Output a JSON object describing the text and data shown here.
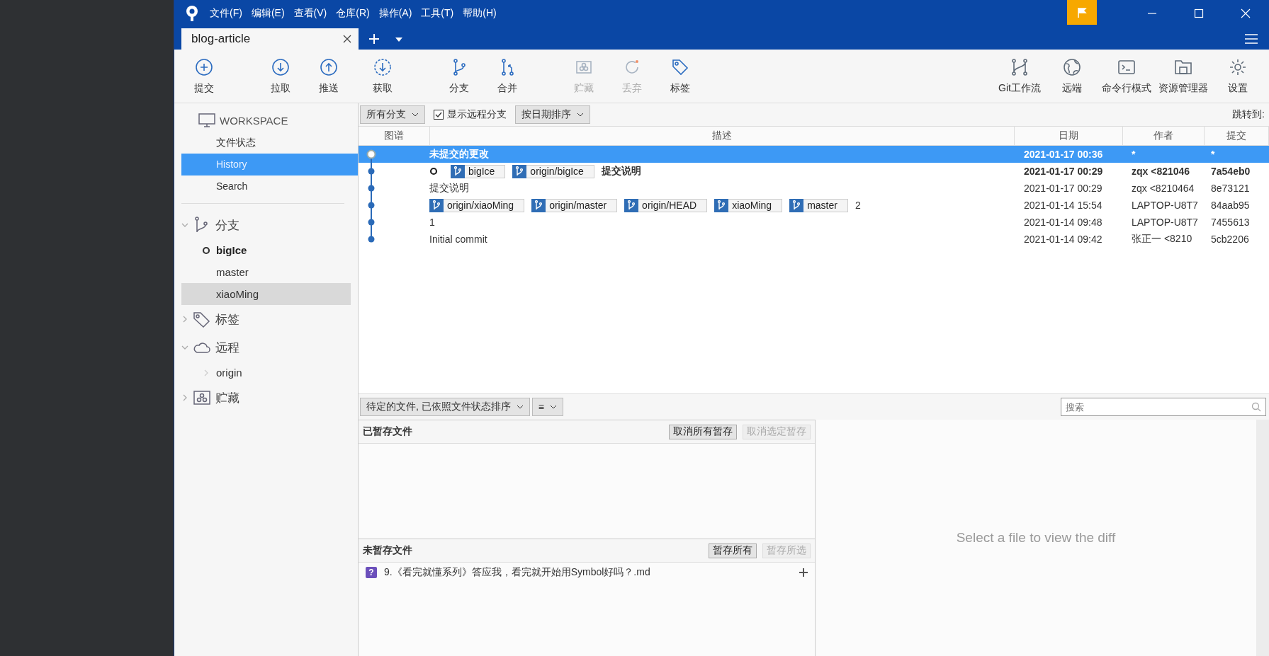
{
  "menu": [
    "文件(F)",
    "编辑(E)",
    "查看(V)",
    "仓库(R)",
    "操作(A)",
    "工具(T)",
    "帮助(H)"
  ],
  "tabs": [
    {
      "label": "blog-article",
      "selected": true
    }
  ],
  "toolbar": [
    {
      "kind": "commit",
      "label": "提交",
      "disabled": false
    },
    {
      "kind": "pull",
      "label": "拉取",
      "disabled": false
    },
    {
      "kind": "push",
      "label": "推送",
      "disabled": false
    },
    {
      "kind": "fetch",
      "label": "获取",
      "disabled": false
    },
    {
      "kind": "branch",
      "label": "分支",
      "disabled": false
    },
    {
      "kind": "merge",
      "label": "合并",
      "disabled": false
    },
    {
      "kind": "stash",
      "label": "贮藏",
      "disabled": true
    },
    {
      "kind": "discard",
      "label": "丢弃",
      "disabled": true
    },
    {
      "kind": "tag",
      "label": "标签",
      "disabled": false
    }
  ],
  "toolbar_right": [
    {
      "kind": "flow",
      "label": "Git工作流"
    },
    {
      "kind": "remote",
      "label": "远端"
    },
    {
      "kind": "terminal",
      "label": "命令行模式"
    },
    {
      "kind": "explorer",
      "label": "资源管理器"
    },
    {
      "kind": "settings",
      "label": "设置"
    }
  ],
  "sidebar": {
    "workspace": {
      "title": "WORKSPACE",
      "items": [
        {
          "label": "文件状态",
          "selected": false
        },
        {
          "label": "History",
          "selected": true
        },
        {
          "label": "Search",
          "selected": false
        }
      ]
    },
    "sections": [
      {
        "kind": "branches",
        "title": "分支",
        "expanded": true,
        "children": [
          {
            "label": "bigIce",
            "current": true,
            "selected": false
          },
          {
            "label": "master",
            "current": false,
            "selected": false
          },
          {
            "label": "xiaoMing",
            "current": false,
            "selected": true
          }
        ]
      },
      {
        "kind": "tags",
        "title": "标签",
        "expanded": false
      },
      {
        "kind": "remotes",
        "title": "远程",
        "expanded": true,
        "children": [
          {
            "label": "origin",
            "current": false,
            "selected": false
          }
        ]
      },
      {
        "kind": "stashes",
        "title": "贮藏",
        "expanded": false
      }
    ]
  },
  "filters": {
    "branches": "所有分支",
    "show_remote": {
      "label": "显示远程分支",
      "checked": true
    },
    "sort": "按日期排序",
    "jump": "跳转到:"
  },
  "table": {
    "columns": [
      "图谱",
      "描述",
      "日期",
      "作者",
      "提交"
    ],
    "rows": [
      {
        "kind": "uncommitted",
        "selected": true,
        "bold": true,
        "refs": [],
        "message": "未提交的更改",
        "date": "2021-01-17 00:36",
        "author": "*",
        "commit": "*"
      },
      {
        "kind": "commit",
        "selected": false,
        "bold": true,
        "refs": [
          {
            "label": "bigIce",
            "current": true
          },
          {
            "label": "origin/bigIce",
            "current": false
          }
        ],
        "message": "提交说明",
        "date": "2021-01-17 00:29",
        "author": "zqx <821046",
        "commit": "7a54eb0"
      },
      {
        "kind": "commit",
        "selected": false,
        "bold": false,
        "refs": [],
        "message": "提交说明",
        "date": "2021-01-17 00:29",
        "author": "zqx <8210464",
        "commit": "8e73121"
      },
      {
        "kind": "commit",
        "selected": false,
        "bold": false,
        "refs": [
          {
            "label": "origin/xiaoMing",
            "current": false
          },
          {
            "label": "origin/master",
            "current": false
          },
          {
            "label": "origin/HEAD",
            "current": false
          },
          {
            "label": "xiaoMing",
            "current": false
          },
          {
            "label": "master",
            "current": false
          }
        ],
        "message": "2",
        "date": "2021-01-14 15:54",
        "author": "LAPTOP-U8T7",
        "commit": "84aab95"
      },
      {
        "kind": "commit",
        "selected": false,
        "bold": false,
        "refs": [],
        "message": "1",
        "date": "2021-01-14 09:48",
        "author": "LAPTOP-U8T7",
        "commit": "7455613"
      },
      {
        "kind": "commit",
        "selected": false,
        "bold": false,
        "refs": [],
        "message": "Initial commit",
        "date": "2021-01-14 09:42",
        "author": "张正一 <8210",
        "commit": "5cb2206"
      }
    ]
  },
  "files_bar": {
    "sort": "待定的文件, 已依照文件状态排序",
    "view": "≡",
    "search_placeholder": "搜索"
  },
  "staged": {
    "title": "已暂存文件",
    "buttons": [
      {
        "label": "取消所有暂存",
        "disabled": false
      },
      {
        "label": "取消选定暂存",
        "disabled": true
      }
    ]
  },
  "unstaged": {
    "title": "未暂存文件",
    "buttons": [
      {
        "label": "暂存所有",
        "disabled": false
      },
      {
        "label": "暂存所选",
        "disabled": true
      }
    ],
    "files": [
      {
        "status": "?",
        "name": "9.《看完就懂系列》答应我，看完就开始用Symbol好吗？.md",
        "color": "#6b4fbb"
      }
    ]
  },
  "diff_placeholder": "Select a file to view the diff"
}
